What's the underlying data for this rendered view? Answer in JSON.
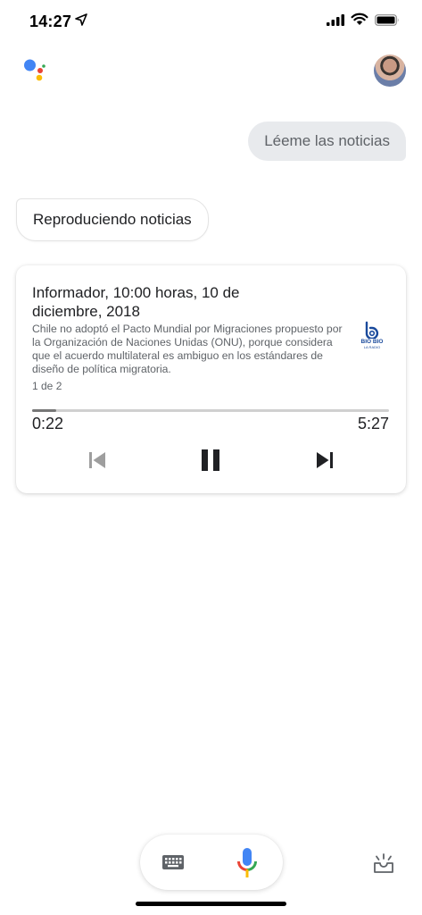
{
  "status_bar": {
    "time": "14:27",
    "icons": [
      "location-arrow-icon",
      "signal-icon",
      "wifi-icon",
      "battery-icon"
    ]
  },
  "header": {
    "logo_icon": "google-assistant-dots-icon",
    "avatar_icon": "user-avatar"
  },
  "conversation": {
    "user_query": "Léeme las noticias",
    "assistant_reply": "Reproduciendo noticias"
  },
  "news_card": {
    "title": "Informador, 10:00 horas, 10 de diciembre, 2018",
    "description": "Chile no adoptó el Pacto Mundial por Migraciones propuesto por la Organización de Naciones Unidas (ONU), porque considera que el acuerdo multilateral es ambiguo en los estándares de diseño de política migratoria.",
    "source_logo": {
      "name": "BIO BIO",
      "subtitle": "LA RADIO"
    },
    "index": "1 de 2",
    "elapsed": "0:22",
    "duration": "5:27",
    "progress_fraction": 0.067,
    "controls": {
      "previous_icon": "skip-previous-icon",
      "pause_icon": "pause-icon",
      "next_icon": "skip-next-icon"
    }
  },
  "bottom_bar": {
    "keyboard_icon": "keyboard-icon",
    "mic_icon": "microphone-icon",
    "updates_icon": "updates-inbox-icon"
  },
  "colors": {
    "google_blue": "#4285F4",
    "google_red": "#EA4335",
    "google_yellow": "#FBBC05",
    "google_green": "#34A853",
    "user_bubble": "#e8eaed"
  }
}
